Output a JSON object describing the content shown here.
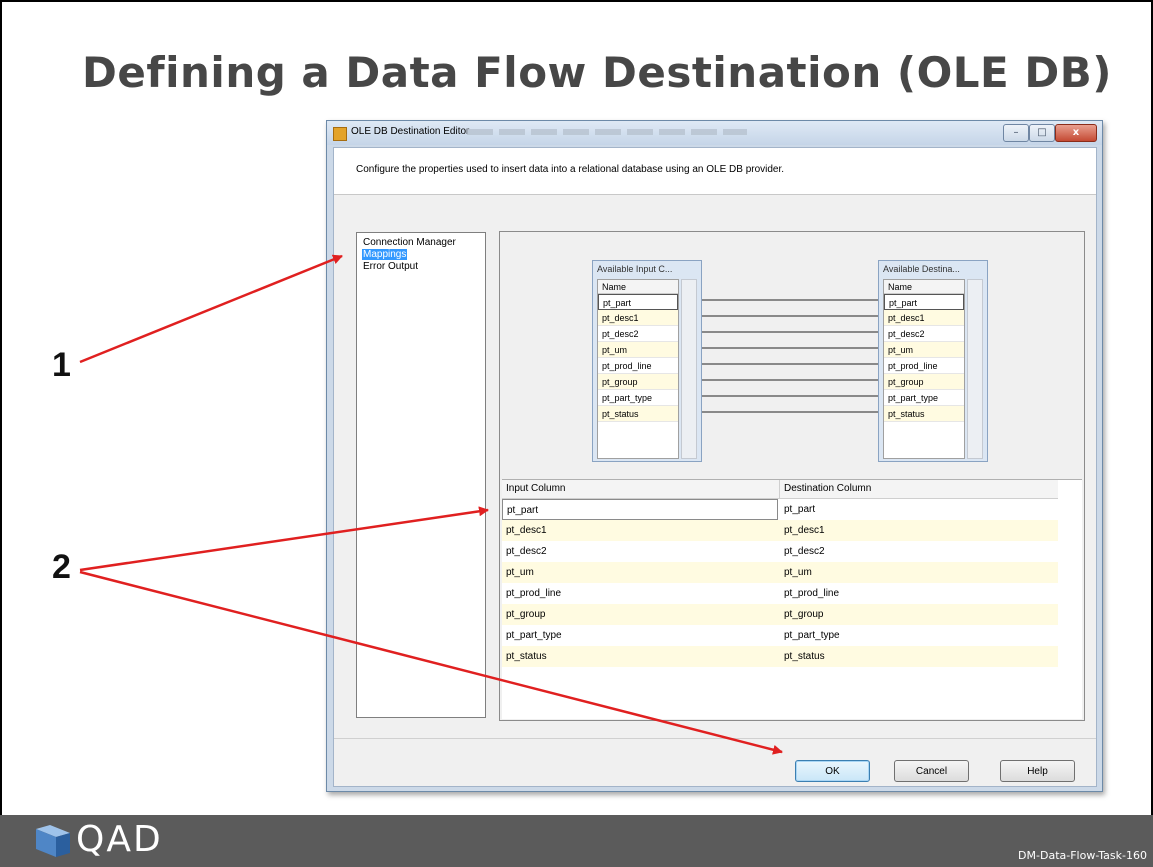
{
  "slide": {
    "title": "Defining a Data Flow Destination (OLE DB)",
    "callouts": [
      "1",
      "2"
    ],
    "footer": {
      "logo_text": "QAD",
      "slide_code": "DM-Data-Flow-Task-160"
    }
  },
  "dialog": {
    "title": "OLE DB Destination Editor",
    "window_buttons": {
      "minimize": "–",
      "maximize": "□",
      "close": "x"
    },
    "description": "Configure the properties used to insert data into a relational database using an OLE DB provider.",
    "nav_items": [
      {
        "label": "Connection Manager",
        "selected": false
      },
      {
        "label": "Mappings",
        "selected": true
      },
      {
        "label": "Error Output",
        "selected": false
      }
    ],
    "mapping": {
      "input_table": {
        "title": "Available Input C...",
        "header": "Name",
        "columns": [
          "pt_part",
          "pt_desc1",
          "pt_desc2",
          "pt_um",
          "pt_prod_line",
          "pt_group",
          "pt_part_type",
          "pt_status"
        ]
      },
      "destination_table": {
        "title": "Available Destina...",
        "header": "Name",
        "columns": [
          "pt_part",
          "pt_desc1",
          "pt_desc2",
          "pt_um",
          "pt_prod_line",
          "pt_group",
          "pt_part_type",
          "pt_status"
        ]
      }
    },
    "grid": {
      "headers": {
        "input": "Input Column",
        "destination": "Destination Column"
      },
      "rows": [
        {
          "input": "pt_part",
          "destination": "pt_part"
        },
        {
          "input": "pt_desc1",
          "destination": "pt_desc1"
        },
        {
          "input": "pt_desc2",
          "destination": "pt_desc2"
        },
        {
          "input": "pt_um",
          "destination": "pt_um"
        },
        {
          "input": "pt_prod_line",
          "destination": "pt_prod_line"
        },
        {
          "input": "pt_group",
          "destination": "pt_group"
        },
        {
          "input": "pt_part_type",
          "destination": "pt_part_type"
        },
        {
          "input": "pt_status",
          "destination": "pt_status"
        }
      ]
    },
    "buttons": {
      "ok": "OK",
      "cancel": "Cancel",
      "help": "Help"
    },
    "colors": {
      "selection": "#3399ff",
      "alt_row": "#fffbe1",
      "arrow": "#e02020"
    }
  }
}
